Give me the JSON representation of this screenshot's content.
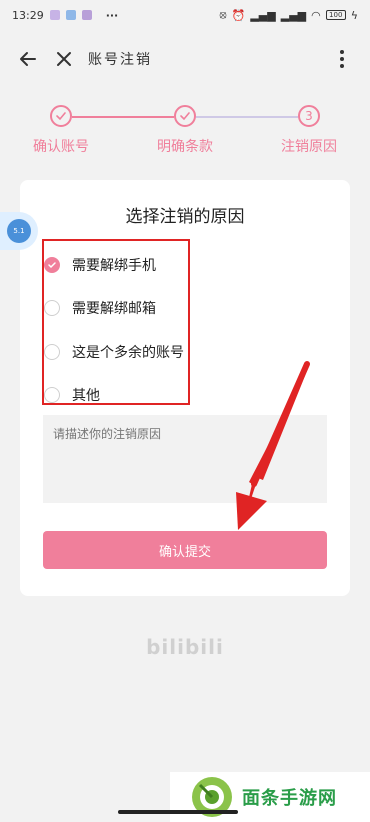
{
  "status_bar": {
    "time": "13:29",
    "dots": "···",
    "battery": "100"
  },
  "nav": {
    "title": "账号注销"
  },
  "steps": [
    {
      "label": "确认账号",
      "state": "done"
    },
    {
      "label": "明确条款",
      "state": "done"
    },
    {
      "label": "注销原因",
      "number": "3",
      "state": "current"
    }
  ],
  "card": {
    "title": "选择注销的原因",
    "options": [
      {
        "label": "需要解绑手机",
        "checked": true
      },
      {
        "label": "需要解绑邮箱",
        "checked": false
      },
      {
        "label": "这是个多余的账号",
        "checked": false
      },
      {
        "label": "其他",
        "checked": false
      }
    ],
    "reason_placeholder": "请描述你的注销原因",
    "submit_label": "确认提交"
  },
  "bubble": {
    "text": "5.1"
  },
  "logo": "bilibili",
  "watermark": {
    "text": "面条手游网"
  },
  "colors": {
    "accent": "#f07f9b",
    "highlight_box": "#e02424",
    "arrow": "#e02424",
    "background": "#f2f2f2"
  }
}
